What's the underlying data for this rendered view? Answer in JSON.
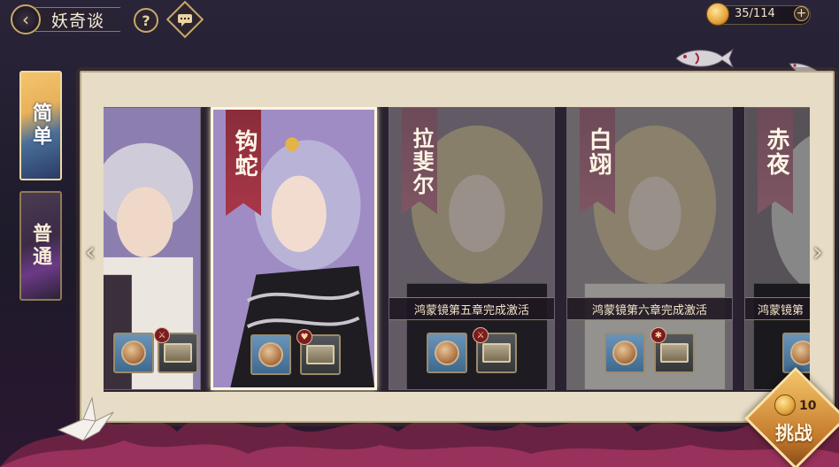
{
  "header": {
    "title": "妖奇谈",
    "stamina": "35/114",
    "stamina_add": "+"
  },
  "difficulty_tabs": [
    {
      "label": "简单",
      "selected": true
    },
    {
      "label": "普通",
      "selected": false
    }
  ],
  "cards": [
    {
      "name": "",
      "locked": false,
      "selected": false,
      "lock_text": ""
    },
    {
      "name": "钩蛇",
      "locked": false,
      "selected": true,
      "lock_text": ""
    },
    {
      "name": "拉斐尔",
      "locked": true,
      "selected": false,
      "lock_text": "鸿蒙镜第五章完成激活"
    },
    {
      "name": "白翊",
      "locked": true,
      "selected": false,
      "lock_text": "鸿蒙镜第六章完成激活"
    },
    {
      "name": "赤夜",
      "locked": true,
      "selected": false,
      "lock_text": "鸿蒙镜第"
    }
  ],
  "challenge": {
    "cost": "10",
    "label": "挑战"
  },
  "colors": {
    "panel": "#e7dcc5",
    "banner": "#a83748",
    "gold": "#c9a868",
    "easy_tab_blue": "#2a3b66",
    "normal_tab_purple": "#6b3a87"
  },
  "icons": [
    "back-arrow-icon",
    "help-icon",
    "chat-icon",
    "coin-icon",
    "plus-icon",
    "chevron-left-icon",
    "chevron-right-icon",
    "medal-icon",
    "chest-icon",
    "sword-badge-icon",
    "heart-badge-icon",
    "crane-icon",
    "koi-icon"
  ]
}
